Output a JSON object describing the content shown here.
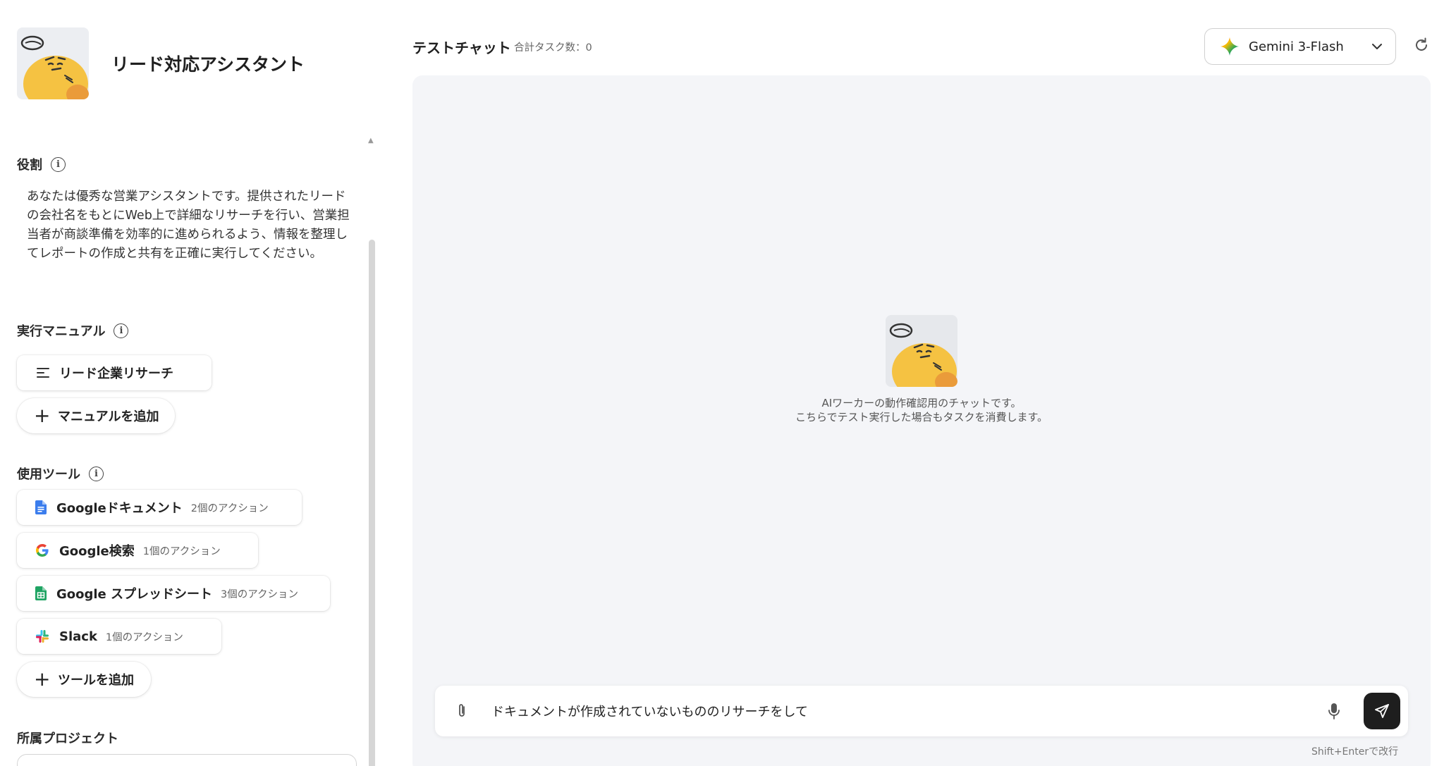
{
  "agent": {
    "name": "リード対応アシスタント"
  },
  "sections": {
    "role_label": "役割",
    "role_text": "あなたは優秀な営業アシスタントです。提供されたリードの会社名をもとにWeb上で詳細なリサーチを行い、営業担当者が商談準備を効率的に進められるよう、情報を整理してレポートの作成と共有を正確に実行してください。",
    "manual_label": "実行マニュアル",
    "manuals": [
      {
        "label": "リード企業リサーチ"
      }
    ],
    "add_manual_label": "マニュアルを追加",
    "tools_label": "使用ツール",
    "tools": [
      {
        "name": "Googleドキュメント",
        "actions": "2個のアクション",
        "icon": "google-docs-icon"
      },
      {
        "name": "Google検索",
        "actions": "1個のアクション",
        "icon": "google-search-icon"
      },
      {
        "name": "Google スプレッドシート",
        "actions": "3個のアクション",
        "icon": "google-sheets-icon"
      },
      {
        "name": "Slack",
        "actions": "1個のアクション",
        "icon": "slack-icon"
      }
    ],
    "add_tool_label": "ツールを追加",
    "project_label": "所属プロジェクト"
  },
  "chat": {
    "title": "テストチャット",
    "task_count": "合計タスク数：0",
    "model": "Gemini 3-Flash",
    "empty_line1": "AIワーカーの動作確認用のチャットです。",
    "empty_line2": "こちらでテスト実行した場合もタスクを消費します。",
    "input_value": "ドキュメントが作成されていないもののリサーチをして",
    "hint": "Shift+Enterで改行"
  },
  "colors": {
    "avatar_yellow": "#f5c242",
    "avatar_orange": "#ea9b3a",
    "chat_bg": "#f4f5f8",
    "send_button": "#1e1e1e"
  }
}
